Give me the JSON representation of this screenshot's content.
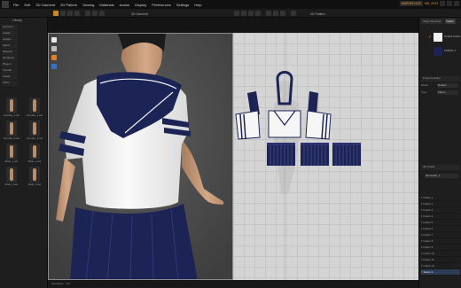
{
  "menu": {
    "items": [
      "File",
      "Edit",
      "3D Garment",
      "2D Pattern",
      "Sewing",
      "Materials",
      "Avatar",
      "Display",
      "Preferences",
      "Settings",
      "Help"
    ]
  },
  "topbar_right": {
    "brand": "MARVELOUS",
    "user": "MD_2023"
  },
  "library": {
    "title": "Library",
    "tree": [
      "Garment",
      "Avatar",
      "Hanger",
      "Fabric",
      "Material",
      "Hardware",
      "Plug-in",
      "Tutorial",
      "Image",
      "Video",
      "Stage"
    ],
    "items": [
      {
        "label": "Female_1.avt"
      },
      {
        "label": "Female_2.avt"
      },
      {
        "label": "Female_3.avt"
      },
      {
        "label": "Female_4.avt"
      },
      {
        "label": "Male_1.avt"
      },
      {
        "label": "Male_2.avt"
      },
      {
        "label": "Male_3.avt"
      },
      {
        "label": "Male_4.avt"
      }
    ]
  },
  "viewport3d": {
    "title": "3D Garment"
  },
  "viewport2d": {
    "title": "2D Pattern"
  },
  "right_panel": {
    "tabs": [
      "Object Browser",
      "Fabric"
    ],
    "fabrics": [
      {
        "name": "Default Fabric",
        "color": "#f2f2f2",
        "selected": true
      },
      {
        "name": "FABRIC 1",
        "color": "#1c2456",
        "selected": false
      }
    ],
    "property_header": "Property Editor",
    "fields": [
      {
        "label": "Name",
        "value": "Default"
      },
      {
        "label": "Type",
        "value": "Fabric"
      }
    ],
    "object_header": "3D Avatar",
    "avatar_name": "3D Avatar_1",
    "objects": [
      "Fabric 1",
      "Fabric 2",
      "Fabric 3",
      "Fabric 4",
      "Fabric 5",
      "Fabric 6",
      "Fabric 7",
      "Fabric 8",
      "Fabric 9",
      "Fabric 10",
      "Fabric 11",
      "Fabric 12",
      "Select 1"
    ]
  },
  "colors": {
    "accent": "#e08a20",
    "navy": "#1c2456",
    "shirt": "#f4f4f4",
    "skin": "#c79a78"
  },
  "status": {
    "text": "Simulation : Off"
  }
}
